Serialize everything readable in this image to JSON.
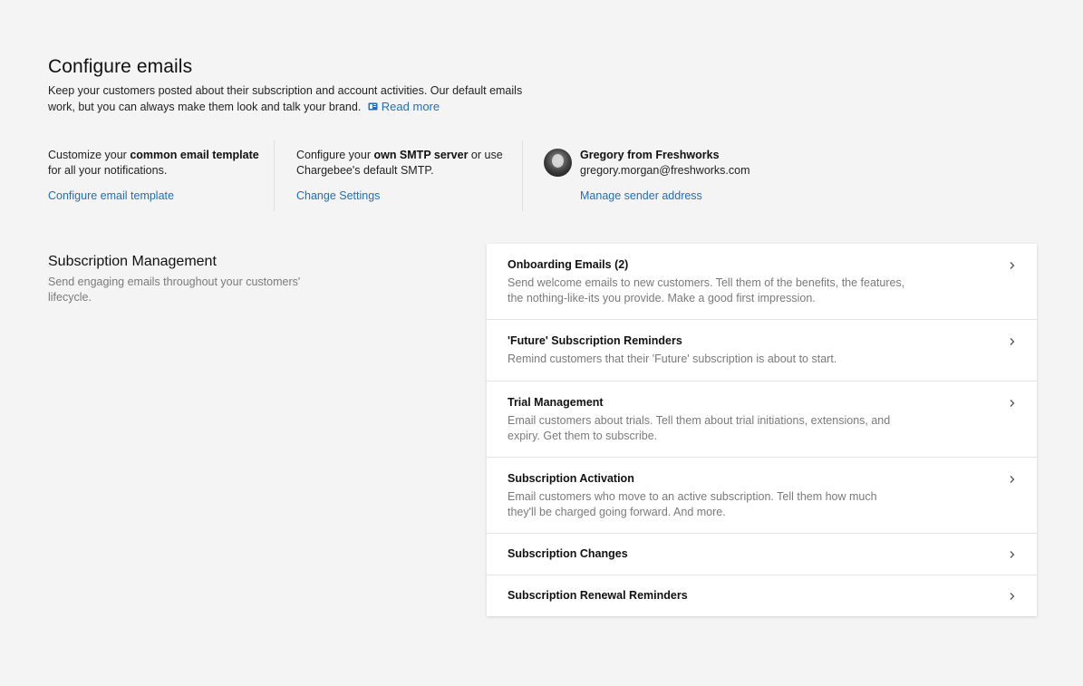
{
  "header": {
    "title": "Configure emails",
    "intro_line1": "Keep your customers posted about their subscription and account activities. Our default emails",
    "intro_line2": "work, but you can always make them look and talk your brand.",
    "read_more": "Read more",
    "read_more_icon": "book-icon"
  },
  "settings": {
    "template": {
      "text_pre": "Customize your ",
      "text_bold": "common email template",
      "text_post": "for all your notifications.",
      "link": "Configure email template"
    },
    "smtp": {
      "text_pre": "Configure your ",
      "text_bold": "own SMTP server",
      "text_mid": " or use",
      "text_post": "Chargebee's default SMTP.",
      "link": "Change Settings"
    },
    "sender": {
      "name": "Gregory from Freshworks",
      "email": "gregory.morgan@freshworks.com",
      "link": "Manage sender address"
    }
  },
  "section": {
    "title": "Subscription Management",
    "description": "Send engaging emails throughout your customers' lifecycle."
  },
  "email_groups": [
    {
      "title": "Onboarding Emails (2)",
      "description": "Send welcome emails to new customers. Tell them of the benefits, the features, the nothing-like-its you provide. Make a good first impression."
    },
    {
      "title": "'Future' Subscription Reminders",
      "description": "Remind customers that their 'Future' subscription is about to start."
    },
    {
      "title": "Trial Management",
      "description": "Email customers about trials. Tell them about trial initiations, extensions, and expiry. Get them to subscribe."
    },
    {
      "title": "Subscription Activation",
      "description": "Email customers who move to an active subscription. Tell them how much they'll be charged going forward. And more."
    },
    {
      "title": "Subscription Changes",
      "description": ""
    },
    {
      "title": "Subscription Renewal Reminders",
      "description": ""
    }
  ],
  "colors": {
    "link": "#1c6ec4",
    "background": "#f4f4f4",
    "muted_text": "#7a7a7a"
  }
}
